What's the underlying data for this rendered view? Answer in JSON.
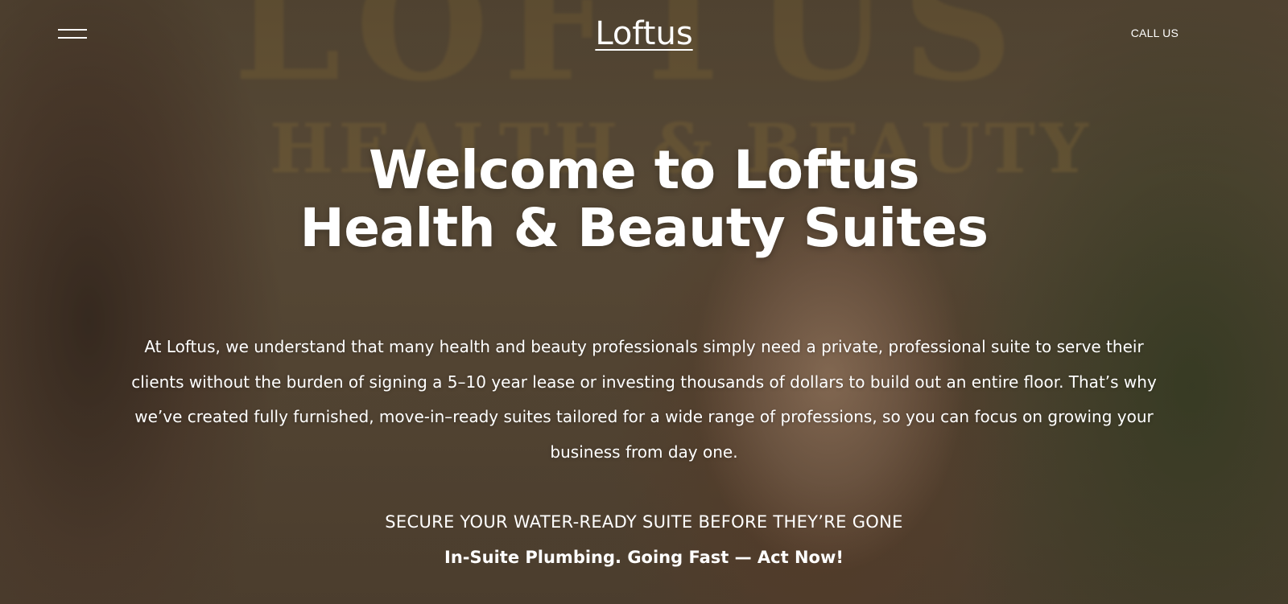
{
  "header": {
    "logo_text": "Loftus",
    "call_label": "CALL US",
    "menu_icon": "hamburger-menu-icon"
  },
  "background": {
    "sign_line_1": "LOFTUS",
    "sign_line_2": "HEALTH & BEAUTY"
  },
  "hero": {
    "headline_line_1": "Welcome to Loftus",
    "headline_line_2": "Health & Beauty Suites",
    "intro": "At Loftus, we understand that many health and beauty professionals simply need a private, professional suite to serve their clients without the burden of signing a 5–10 year lease or investing thousands of dollars to build out an entire floor. That’s why we’ve created fully furnished, move-in–ready suites tailored for a wide range of professions, so you can focus on growing your business from day one.",
    "cta_heading": "SECURE YOUR WATER-READY SUITE BEFORE THEY’RE GONE",
    "cta_subheading": "In-Suite Plumbing. Going Fast — Act Now!"
  },
  "colors": {
    "text": "#ffffff",
    "overlay": "#3c2e22",
    "sign_gold": "#9b8048"
  }
}
